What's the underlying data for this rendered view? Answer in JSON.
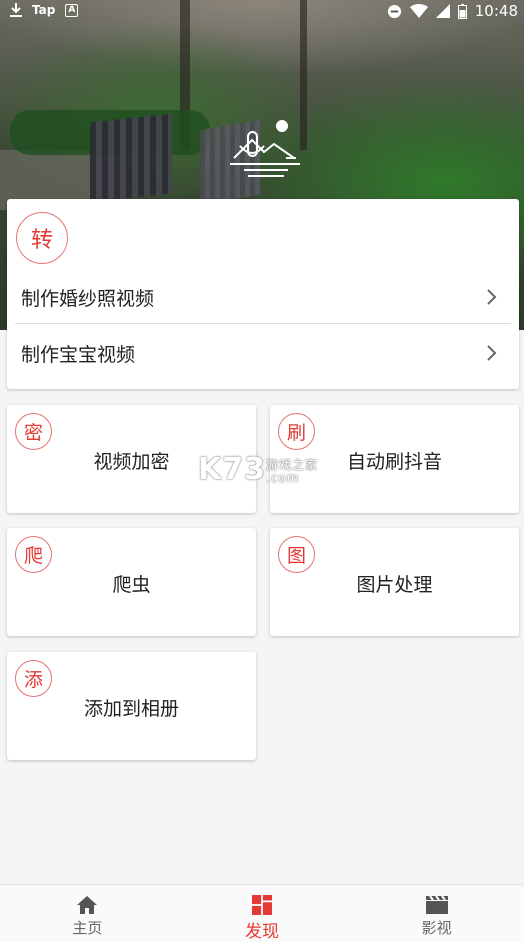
{
  "status_bar": {
    "tap": "Tap",
    "a_icon": "A",
    "time": "10:48"
  },
  "top_card": {
    "badge": "转",
    "rows": [
      {
        "label": "制作婚纱照视频"
      },
      {
        "label": "制作宝宝视频"
      }
    ]
  },
  "tiles": [
    {
      "badge": "密",
      "label": "视频加密"
    },
    {
      "badge": "刷",
      "label": "自动刷抖音"
    },
    {
      "badge": "爬",
      "label": "爬虫"
    },
    {
      "badge": "图",
      "label": "图片处理"
    },
    {
      "badge": "添",
      "label": "添加到相册"
    }
  ],
  "watermark": {
    "brand": "K73",
    "tagline": "游戏之家",
    "domain": ".com"
  },
  "bottom_nav": {
    "items": [
      {
        "label": "主页",
        "icon": "home-icon"
      },
      {
        "label": "发现",
        "icon": "discover-icon",
        "active": true
      },
      {
        "label": "影视",
        "icon": "clapperboard-icon"
      }
    ]
  },
  "colors": {
    "accent": "#e53935",
    "badge_border": "#e57373"
  }
}
